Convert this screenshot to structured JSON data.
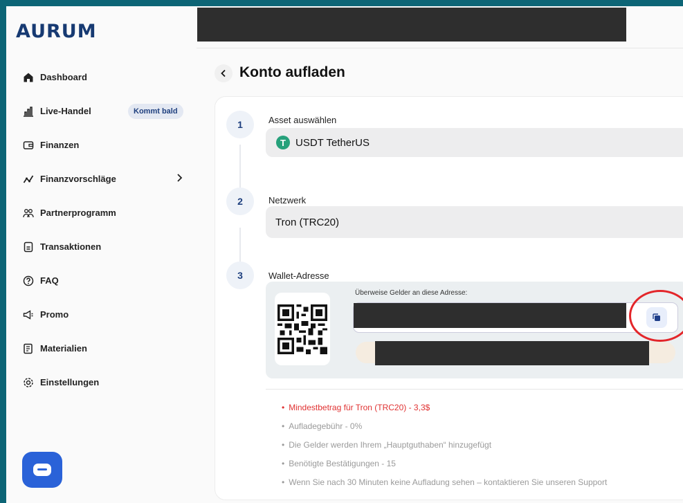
{
  "brand": {
    "logo": "AURUM"
  },
  "sidebar": {
    "items": [
      {
        "label": "Dashboard",
        "icon": "home-icon"
      },
      {
        "label": "Live-Handel",
        "icon": "bar-chart-icon",
        "badge": "Kommt bald"
      },
      {
        "label": "Finanzen",
        "icon": "wallet-icon"
      },
      {
        "label": "Finanzvorschläge",
        "icon": "trend-icon",
        "has_chevron": true
      },
      {
        "label": "Partnerprogramm",
        "icon": "people-icon"
      },
      {
        "label": "Transaktionen",
        "icon": "document-icon"
      },
      {
        "label": "FAQ",
        "icon": "question-icon"
      },
      {
        "label": "Promo",
        "icon": "megaphone-icon"
      },
      {
        "label": "Materialien",
        "icon": "book-icon"
      },
      {
        "label": "Einstellungen",
        "icon": "gear-icon"
      }
    ]
  },
  "page": {
    "title": "Konto aufladen"
  },
  "steps": [
    {
      "number": "1",
      "label": "Asset auswählen",
      "value": "USDT TetherUS",
      "icon": "tether-icon"
    },
    {
      "number": "2",
      "label": "Netzwerk",
      "value": "Tron (TRC20)"
    },
    {
      "number": "3",
      "label": "Wallet-Adresse"
    }
  ],
  "wallet": {
    "transfer_label": "Überweise Gelder an diese Adresse:"
  },
  "notes": [
    {
      "text": "Mindestbetrag für Tron (TRC20) - 3,3$",
      "highlight": true
    },
    {
      "text": "Aufladegebühr - 0%"
    },
    {
      "text": "Die Gelder werden Ihrem „Hauptguthaben“ hinzugefügt"
    },
    {
      "text": "Benötigte Bestätigungen - 15"
    },
    {
      "text": "Wenn Sie nach 30 Minuten keine Aufladung sehen – kontaktieren Sie unseren Support"
    }
  ],
  "colors": {
    "brand": "#173a72",
    "accent": "#2a62d8",
    "warning": "#e03131",
    "frame": "#0d6576"
  }
}
